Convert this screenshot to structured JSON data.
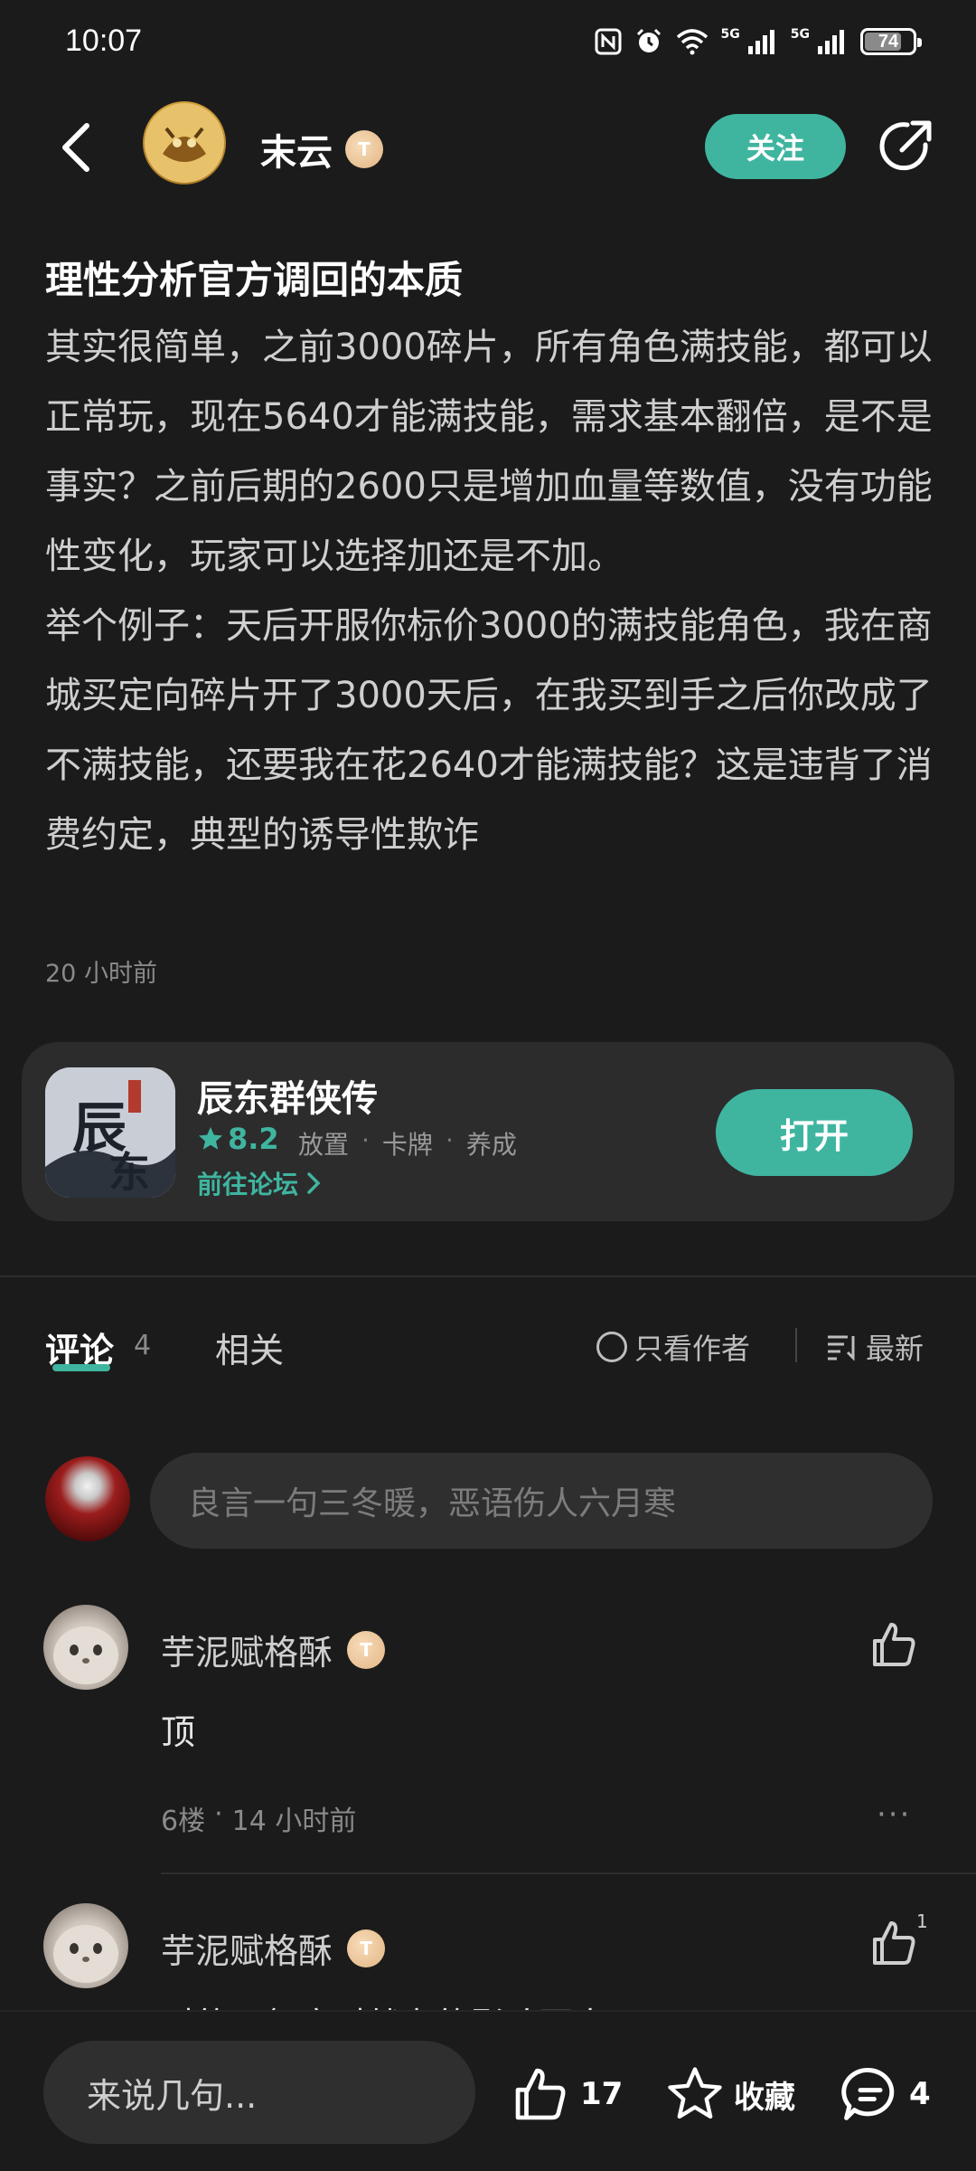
{
  "status_bar": {
    "time": "10:07",
    "signal1_label": "5G",
    "signal2_label": "5G",
    "battery": "74"
  },
  "header": {
    "author_name": "末云",
    "follow_label": "关注",
    "icons": {
      "back": "back-chevron-icon",
      "share": "share-icon",
      "level": "level-badge-icon"
    }
  },
  "post": {
    "title": "理性分析官方调回的本质",
    "body": "其实很简单，之前3000碎片，所有角色满技能，都可以正常玩，现在5640才能满技能，需求基本翻倍，是不是事实？之前后期的2600只是增加血量等数值，没有功能性变化，玩家可以选择加还是不加。\n举个例子：天后开服你标价3000的满技能角色，我在商城买定向碎片开了3000天后，在我买到手之后你改成了不满技能，还要我在花2640才能满技能？这是违背了消费约定，典型的诱导性欺诈",
    "time": "20 小时前"
  },
  "game_card": {
    "name": "辰东群侠传",
    "rating": "8.2",
    "tags": [
      "放置",
      "卡牌",
      "养成"
    ],
    "forum_link": "前往论坛",
    "open_label": "打开",
    "accent": "#3fb5a0"
  },
  "tabs": {
    "comments_label": "评论",
    "comments_count": "4",
    "related_label": "相关",
    "only_author_label": "只看作者",
    "sort_label": "最新"
  },
  "comment_input": {
    "placeholder": "良言一句三冬暖，恶语伤人六月寒"
  },
  "comments": [
    {
      "name": "芋泥赋格酥",
      "text": "顶",
      "floor": "6楼",
      "time": "14 小时前",
      "likes": ""
    },
    {
      "name": "芋泥赋格酥",
      "text": "对的，氪度对战力的影响更大了",
      "likes": "1"
    }
  ],
  "bottom_bar": {
    "input_placeholder": "来说几句...",
    "like_count": "17",
    "favorite_label": "收藏",
    "comment_count": "4"
  }
}
